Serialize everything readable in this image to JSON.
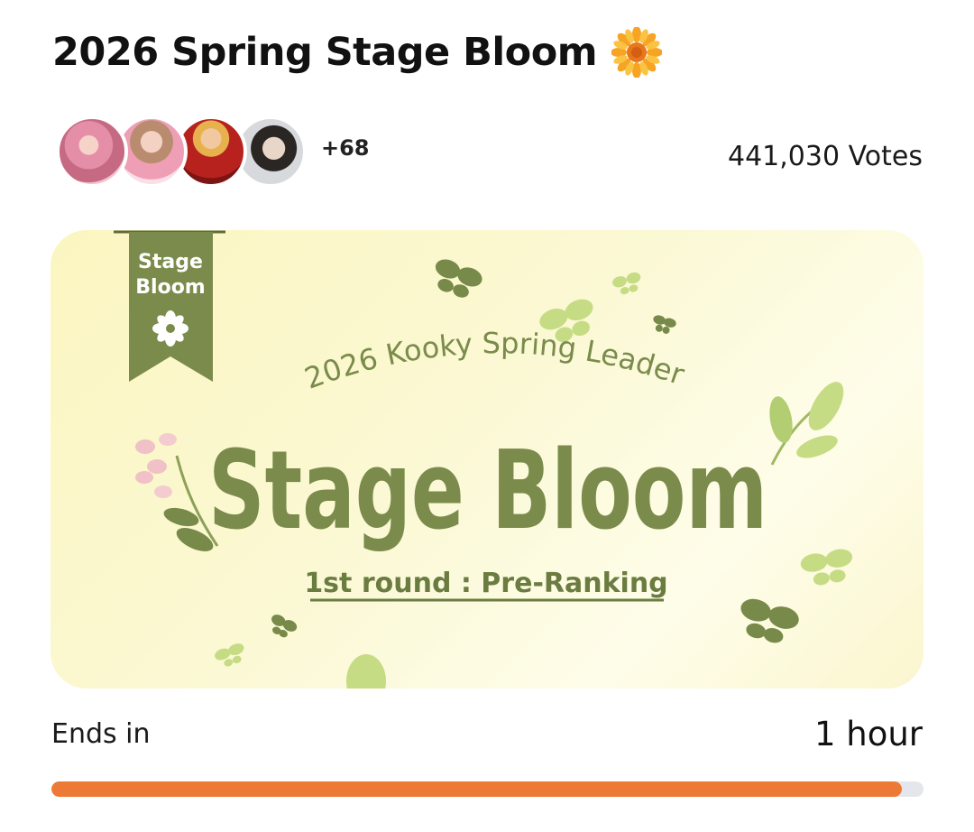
{
  "header": {
    "title": "2026 Spring Stage Bloom",
    "title_icon": "sunflower-icon"
  },
  "participants": {
    "avatars": [
      "participant-avatar-1",
      "participant-avatar-2",
      "participant-avatar-3",
      "participant-avatar-4"
    ],
    "more_count": "+68"
  },
  "votes": {
    "label": "441,030 Votes"
  },
  "banner": {
    "ribbon_line1": "Stage",
    "ribbon_line2": "Bloom",
    "subtitle": "2026 Kooky Spring Leader",
    "headline": "Stage Bloom",
    "round": "1st round : Pre-Ranking",
    "colors": {
      "accent_green": "#788a4a",
      "light_green": "#c6dc84",
      "background": "#fbf7cc",
      "flower_pink": "#f0c1c6"
    }
  },
  "timer": {
    "label": "Ends in",
    "value": "1 hour",
    "progress": 0.975,
    "bar_color": "#ec7a36",
    "track_color": "#e4e6eb"
  }
}
